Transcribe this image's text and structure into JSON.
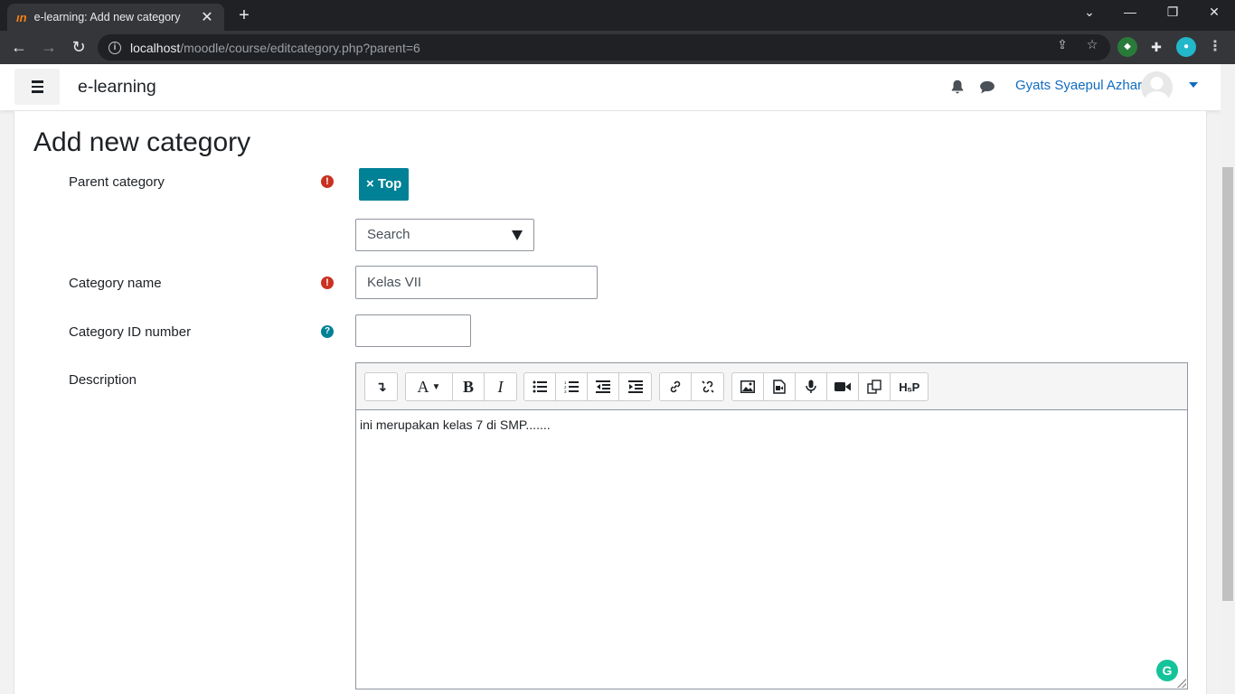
{
  "browser": {
    "tab_title": "e-learning: Add new category",
    "tab_favicon": "ın",
    "url_host": "localhost",
    "url_path": "/moodle/course/editcategory.php?parent=6"
  },
  "navbar": {
    "brand": "e-learning",
    "username": "Gyats Syaepul Azhar"
  },
  "page": {
    "title": "Add new category"
  },
  "form": {
    "parent_category": {
      "label": "Parent category",
      "selected_tag": "× Top",
      "search_placeholder": "Search"
    },
    "category_name": {
      "label": "Category name",
      "value": "Kelas VII"
    },
    "category_id": {
      "label": "Category ID number",
      "value": ""
    },
    "description": {
      "label": "Description",
      "value": "ini merupakan kelas 7 di SMP......."
    }
  },
  "icons": {
    "required": "!",
    "help": "?",
    "grammarly": "G"
  },
  "colors": {
    "accent": "#008196",
    "link": "#0f6cbf",
    "required": "#ca3120",
    "browser_bg": "#202124"
  }
}
